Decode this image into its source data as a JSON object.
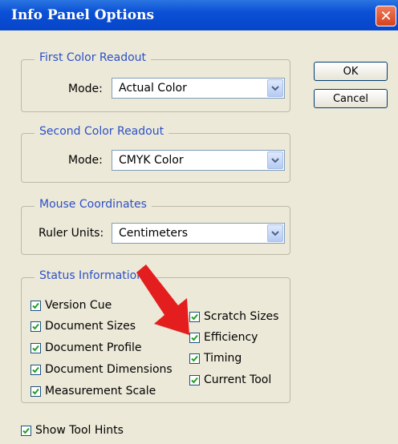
{
  "dialog": {
    "title": "Info Panel Options",
    "close_glyph": "✕"
  },
  "buttons": {
    "ok": "OK",
    "cancel": "Cancel"
  },
  "first_readout": {
    "legend": "First Color Readout",
    "mode_label": "Mode:",
    "mode_value": "Actual Color"
  },
  "second_readout": {
    "legend": "Second Color Readout",
    "mode_label": "Mode:",
    "mode_value": "CMYK Color"
  },
  "mouse_coordinates": {
    "legend": "Mouse Coordinates",
    "units_label": "Ruler Units:",
    "units_value": "Centimeters"
  },
  "status": {
    "legend": "Status Information",
    "left_items": [
      {
        "label": "Version Cue",
        "checked": true
      },
      {
        "label": "Document Sizes",
        "checked": true
      },
      {
        "label": "Document Profile",
        "checked": true
      },
      {
        "label": "Document Dimensions",
        "checked": true
      },
      {
        "label": "Measurement Scale",
        "checked": true
      }
    ],
    "right_items": [
      {
        "label": "Scratch Sizes",
        "checked": true
      },
      {
        "label": "Efficiency",
        "checked": true
      },
      {
        "label": "Timing",
        "checked": true
      },
      {
        "label": "Current Tool",
        "checked": true
      }
    ]
  },
  "show_tool_hints": {
    "label": "Show Tool Hints",
    "checked": true
  },
  "colors": {
    "titlebar": "#0b50d6",
    "legend_text": "#2c50c8",
    "annotation_arrow": "#e41e1e",
    "checkmark": "#21a121"
  }
}
